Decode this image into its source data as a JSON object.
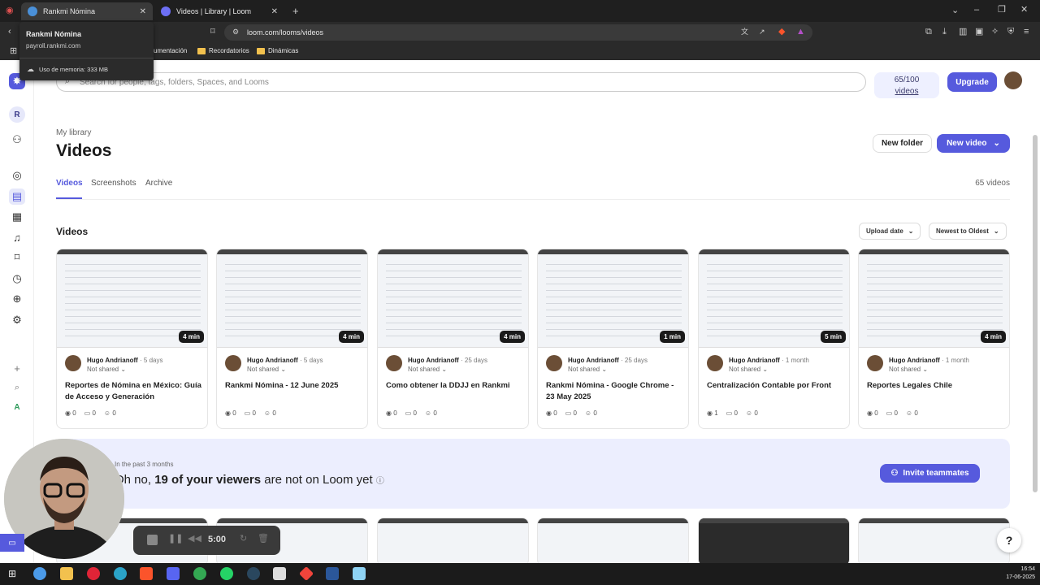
{
  "browser": {
    "tabs": [
      {
        "title": "Rankmi Nómina",
        "active": true
      },
      {
        "title": "Videos | Library | Loom",
        "active": false
      }
    ],
    "url": "loom.com/looms/videos",
    "bookmarks": [
      "umentación",
      "Recordatorios",
      "Dinámicas"
    ],
    "tooltip": {
      "title": "Rankmi Nómina",
      "domain": "payroll.rankmi.com",
      "memory": "Uso de memoria: 333 MB"
    }
  },
  "header": {
    "search_placeholder": "Search for people, tags, folders, Spaces, and Looms",
    "quota_count": "65/100",
    "quota_label": "videos",
    "upgrade_label": "Upgrade"
  },
  "sidebar": {
    "workspace_initial": "R",
    "bottom_initial": "A"
  },
  "library": {
    "label": "My library",
    "title": "Videos",
    "new_folder": "New folder",
    "new_video": "New video",
    "tabs": [
      "Videos",
      "Screenshots",
      "Archive"
    ],
    "count": "65 videos",
    "section_title": "Videos",
    "sort_field": "Upload date",
    "sort_order": "Newest to Oldest"
  },
  "videos": [
    {
      "author": "Hugo Andrianoff",
      "age": "· 5 days",
      "sharing": "Not shared",
      "title": "Reportes de Nómina en México: Guía de Acceso y Generación",
      "duration": "4 min",
      "views": "0",
      "comments": "0",
      "reactions": "0"
    },
    {
      "author": "Hugo Andrianoff",
      "age": "· 5 days",
      "sharing": "Not shared",
      "title": "Rankmi Nómina - 12 June 2025",
      "duration": "4 min",
      "views": "0",
      "comments": "0",
      "reactions": "0"
    },
    {
      "author": "Hugo Andrianoff",
      "age": "· 25 days",
      "sharing": "Not shared",
      "title": "Como obtener la DDJJ en Rankmi",
      "duration": "4 min",
      "views": "0",
      "comments": "0",
      "reactions": "0"
    },
    {
      "author": "Hugo Andrianoff",
      "age": "· 25 days",
      "sharing": "Not shared",
      "title": "Rankmi Nómina - Google Chrome - 23 May 2025",
      "duration": "1 min",
      "views": "0",
      "comments": "0",
      "reactions": "0"
    },
    {
      "author": "Hugo Andrianoff",
      "age": "· 1 month",
      "sharing": "Not shared",
      "title": "Centralización Contable por Front",
      "duration": "5 min",
      "views": "1",
      "comments": "0",
      "reactions": "0"
    },
    {
      "author": "Hugo Andrianoff",
      "age": "· 1 month",
      "sharing": "Not shared",
      "title": "Reportes Legales Chile",
      "duration": "4 min",
      "views": "0",
      "comments": "0",
      "reactions": "0"
    }
  ],
  "banner": {
    "eyebrow": "In the past 3 months",
    "prefix": "Oh no, ",
    "highlight": "19 of your viewers",
    "suffix": " are not on Loom yet",
    "invite_label": "Invite teammates"
  },
  "recorder": {
    "time": "5:00"
  },
  "help_label": "?",
  "taskbar": {
    "time": "16:54",
    "date": "17-06-2025"
  },
  "colors": {
    "accent": "#565ADD",
    "banner_bg": "#ECEEFE"
  }
}
